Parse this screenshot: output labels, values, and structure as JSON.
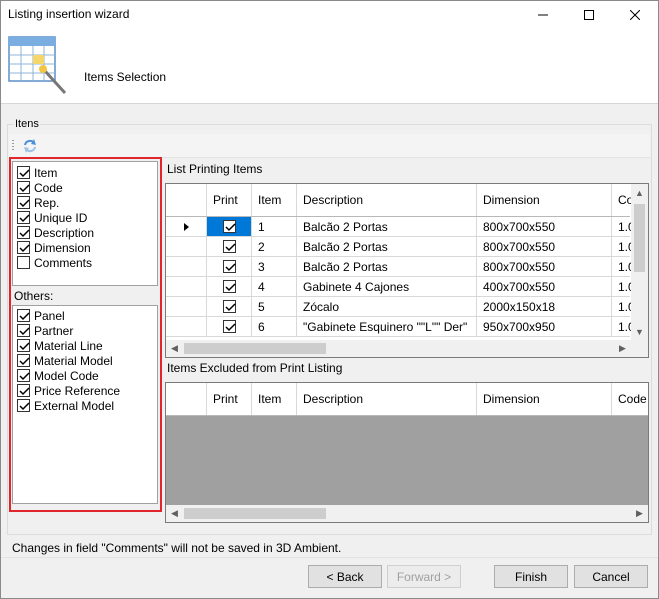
{
  "window": {
    "title": "Listing insertion wizard"
  },
  "header": {
    "title": "Items Selection"
  },
  "group": {
    "label": "Itens"
  },
  "fields": [
    {
      "label": "Item",
      "checked": true
    },
    {
      "label": "Code",
      "checked": true
    },
    {
      "label": "Rep.",
      "checked": true
    },
    {
      "label": "Unique ID",
      "checked": true
    },
    {
      "label": "Description",
      "checked": true
    },
    {
      "label": "Dimension",
      "checked": true
    },
    {
      "label": "Comments",
      "checked": false
    }
  ],
  "others": {
    "label": "Others:",
    "items": [
      {
        "label": "Panel",
        "checked": true
      },
      {
        "label": "Partner",
        "checked": true
      },
      {
        "label": "Material Line",
        "checked": true
      },
      {
        "label": "Material Model",
        "checked": true
      },
      {
        "label": "Model  Code",
        "checked": true
      },
      {
        "label": "Price Reference",
        "checked": true
      },
      {
        "label": "External  Model",
        "checked": true
      }
    ]
  },
  "print_list": {
    "label": "List Printing Items",
    "columns": [
      "Print",
      "Item",
      "Description",
      "Dimension",
      "Co"
    ],
    "rows": [
      {
        "print": true,
        "item": "1",
        "description": "Balcão 2 Portas",
        "dimension": "800x700x550",
        "code": "1.0"
      },
      {
        "print": true,
        "item": "2",
        "description": "Balcão 2 Portas",
        "dimension": "800x700x550",
        "code": "1.0"
      },
      {
        "print": true,
        "item": "3",
        "description": "Balcão 2 Portas",
        "dimension": "800x700x550",
        "code": "1.0"
      },
      {
        "print": true,
        "item": "4",
        "description": "Gabinete 4 Cajones",
        "dimension": "400x700x550",
        "code": "1.0"
      },
      {
        "print": true,
        "item": "5",
        "description": "Zócalo",
        "dimension": "2000x150x18",
        "code": "1.0"
      },
      {
        "print": true,
        "item": "6",
        "description": "\"Gabinete Esquinero \"\"L\"\" Der\"",
        "dimension": "950x700x950",
        "code": "1.0"
      }
    ]
  },
  "excluded_list": {
    "label": "Items Excluded from Print Listing",
    "columns": [
      "Print",
      "Item",
      "Description",
      "Dimension",
      "Code"
    ]
  },
  "info": {
    "text": "Changes in field \"Comments\" will not be saved in 3D Ambient."
  },
  "buttons": {
    "back": "< Back",
    "forward": "Forward >",
    "finish": "Finish",
    "cancel": "Cancel"
  },
  "colors": {
    "selection": "#0078d7",
    "highlight_frame": "#e0262c",
    "grid_empty": "#a0a0a0"
  },
  "icons": {
    "header": "table-wizard-icon",
    "toolbar": "refresh-icon"
  }
}
